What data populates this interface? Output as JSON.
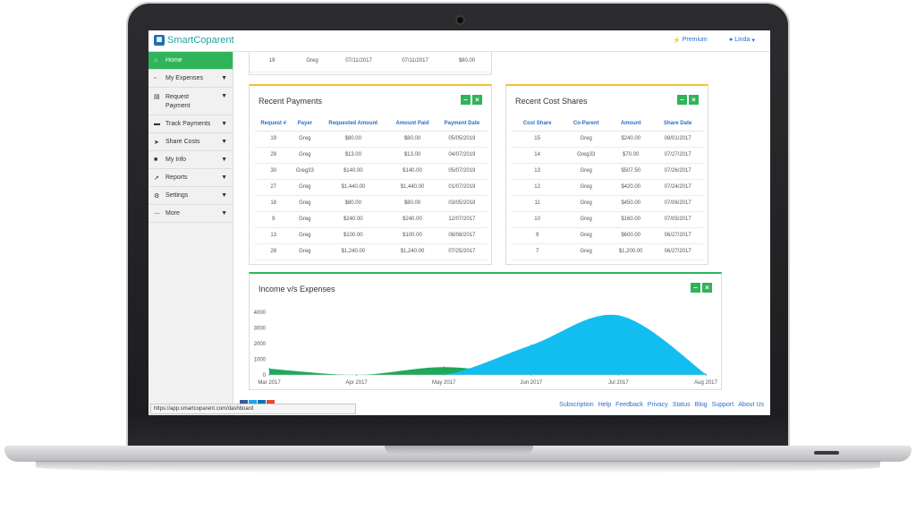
{
  "app": {
    "name": "SmartCoparent",
    "premium_label": "Premium",
    "user_label": "Linda"
  },
  "sidebar": {
    "items": [
      {
        "label": "Home",
        "icon": "home-icon"
      },
      {
        "label": "My Expenses",
        "icon": "car-icon"
      },
      {
        "label": "Request Payment",
        "icon": "money-icon"
      },
      {
        "label": "Track Payments",
        "icon": "credit-card-icon"
      },
      {
        "label": "Share Costs",
        "icon": "send-icon"
      },
      {
        "label": "My Info",
        "icon": "folder-icon"
      },
      {
        "label": "Reports",
        "icon": "line-chart-icon"
      },
      {
        "label": "Settings",
        "icon": "gear-icon"
      },
      {
        "label": "More",
        "icon": "ellipsis-icon"
      }
    ]
  },
  "top_fragment": {
    "row": [
      "19",
      "Greg",
      "07/11/2017",
      "07/11/2017",
      "$80.00"
    ]
  },
  "recent_payments": {
    "title": "Recent Payments",
    "columns": [
      "Request #",
      "Payer",
      "Requested Amount",
      "Amount Paid",
      "Payment Date"
    ],
    "rows": [
      [
        "19",
        "Greg",
        "$80.00",
        "$80.00",
        "05/05/2019"
      ],
      [
        "29",
        "Greg",
        "$13.00",
        "$13.00",
        "04/07/2019"
      ],
      [
        "30",
        "Greg33",
        "$140.00",
        "$140.00",
        "05/07/2019"
      ],
      [
        "27",
        "Greg",
        "$1,440.00",
        "$1,440.00",
        "01/07/2019"
      ],
      [
        "18",
        "Greg",
        "$80.00",
        "$80.00",
        "03/05/2018"
      ],
      [
        "9",
        "Greg",
        "$240.00",
        "$240.00",
        "12/07/2017"
      ],
      [
        "13",
        "Greg",
        "$100.00",
        "$100.00",
        "08/08/2017"
      ],
      [
        "28",
        "Greg",
        "$1,240.00",
        "$1,240.00",
        "07/25/2017"
      ]
    ]
  },
  "recent_cost_shares": {
    "title": "Recent Cost Shares",
    "columns": [
      "Cost Share",
      "Co-Parent",
      "Amount",
      "Share Date"
    ],
    "rows": [
      [
        "15",
        "Greg",
        "$240.00",
        "08/01/2017"
      ],
      [
        "14",
        "Greg33",
        "$70.00",
        "07/27/2017"
      ],
      [
        "13",
        "Greg",
        "$507.50",
        "07/26/2017"
      ],
      [
        "12",
        "Greg",
        "$420.00",
        "07/24/2017"
      ],
      [
        "11",
        "Greg",
        "$450.00",
        "07/06/2017"
      ],
      [
        "10",
        "Greg",
        "$160.00",
        "07/05/2017"
      ],
      [
        "9",
        "Greg",
        "$600.00",
        "06/27/2017"
      ],
      [
        "7",
        "Greg",
        "$1,200.00",
        "06/27/2017"
      ]
    ]
  },
  "income_expenses": {
    "title": "Income v/s Expenses"
  },
  "chart_data": {
    "type": "area",
    "title": "Income v/s Expenses",
    "x": [
      "Mar 2017",
      "Apr 2017",
      "May 2017",
      "Jun 2017",
      "Jul 2017",
      "Aug 2017"
    ],
    "y_ticks": [
      "4000",
      "3000",
      "2000",
      "1000",
      "0"
    ],
    "ylim": [
      0,
      4000
    ],
    "series": [
      {
        "values": [
          400,
          0,
          500,
          0,
          0,
          0
        ],
        "color": "#1fa85a"
      },
      {
        "values": [
          0,
          0,
          0,
          1900,
          3800,
          50
        ],
        "color": "#12bdf0"
      }
    ]
  },
  "status_bar": {
    "url": "https://app.smartcoparent.com/dashboard"
  },
  "footer": {
    "links": [
      "Subscription",
      "Help",
      "Feedback",
      "Privacy",
      "Status",
      "Blog",
      "Support",
      "About Us"
    ]
  },
  "colors": {
    "brand_green": "#2fb45a",
    "link_blue": "#2a6fc9",
    "panel_accent_yellow": "#f2c231"
  }
}
